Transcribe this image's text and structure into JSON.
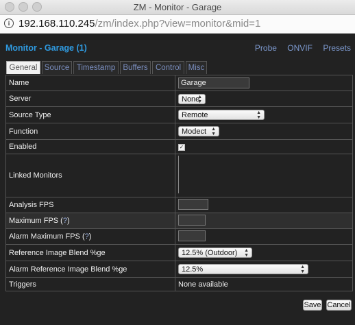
{
  "window": {
    "title": "ZM - Monitor - Garage"
  },
  "address": {
    "host": "192.168.110.245",
    "path": "/zm/index.php?view=monitor&mid=1"
  },
  "page": {
    "title": "Monitor - Garage (1)",
    "links": [
      "Probe",
      "ONVIF",
      "Presets"
    ]
  },
  "tabs": [
    "General",
    "Source",
    "Timestamp",
    "Buffers",
    "Control",
    "Misc"
  ],
  "rows": {
    "name": {
      "label": "Name",
      "value": "Garage"
    },
    "server": {
      "label": "Server",
      "value": "None"
    },
    "source_type": {
      "label": "Source Type",
      "value": "Remote"
    },
    "function": {
      "label": "Function",
      "value": "Modect"
    },
    "enabled": {
      "label": "Enabled",
      "check": "✓"
    },
    "linked": {
      "label": "Linked Monitors"
    },
    "analysis_fps": {
      "label": "Analysis FPS"
    },
    "max_fps": {
      "label_pre": "Maximum FPS (",
      "help": "?",
      "label_post": ")"
    },
    "alarm_max_fps": {
      "label_pre": "Alarm Maximum FPS (",
      "help": "?",
      "label_post": ")"
    },
    "ref_blend": {
      "label": "Reference Image Blend %ge",
      "value": "12.5% (Outdoor)"
    },
    "alarm_ref_blend": {
      "label": "Alarm Reference Image Blend %ge",
      "value": "12.5%"
    },
    "triggers": {
      "label": "Triggers",
      "value": "None available"
    }
  },
  "buttons": {
    "save": "Save",
    "cancel": "Cancel"
  },
  "colors": {
    "accent": "#2f9ae0",
    "link": "#7e9bd1",
    "background": "#222222"
  }
}
